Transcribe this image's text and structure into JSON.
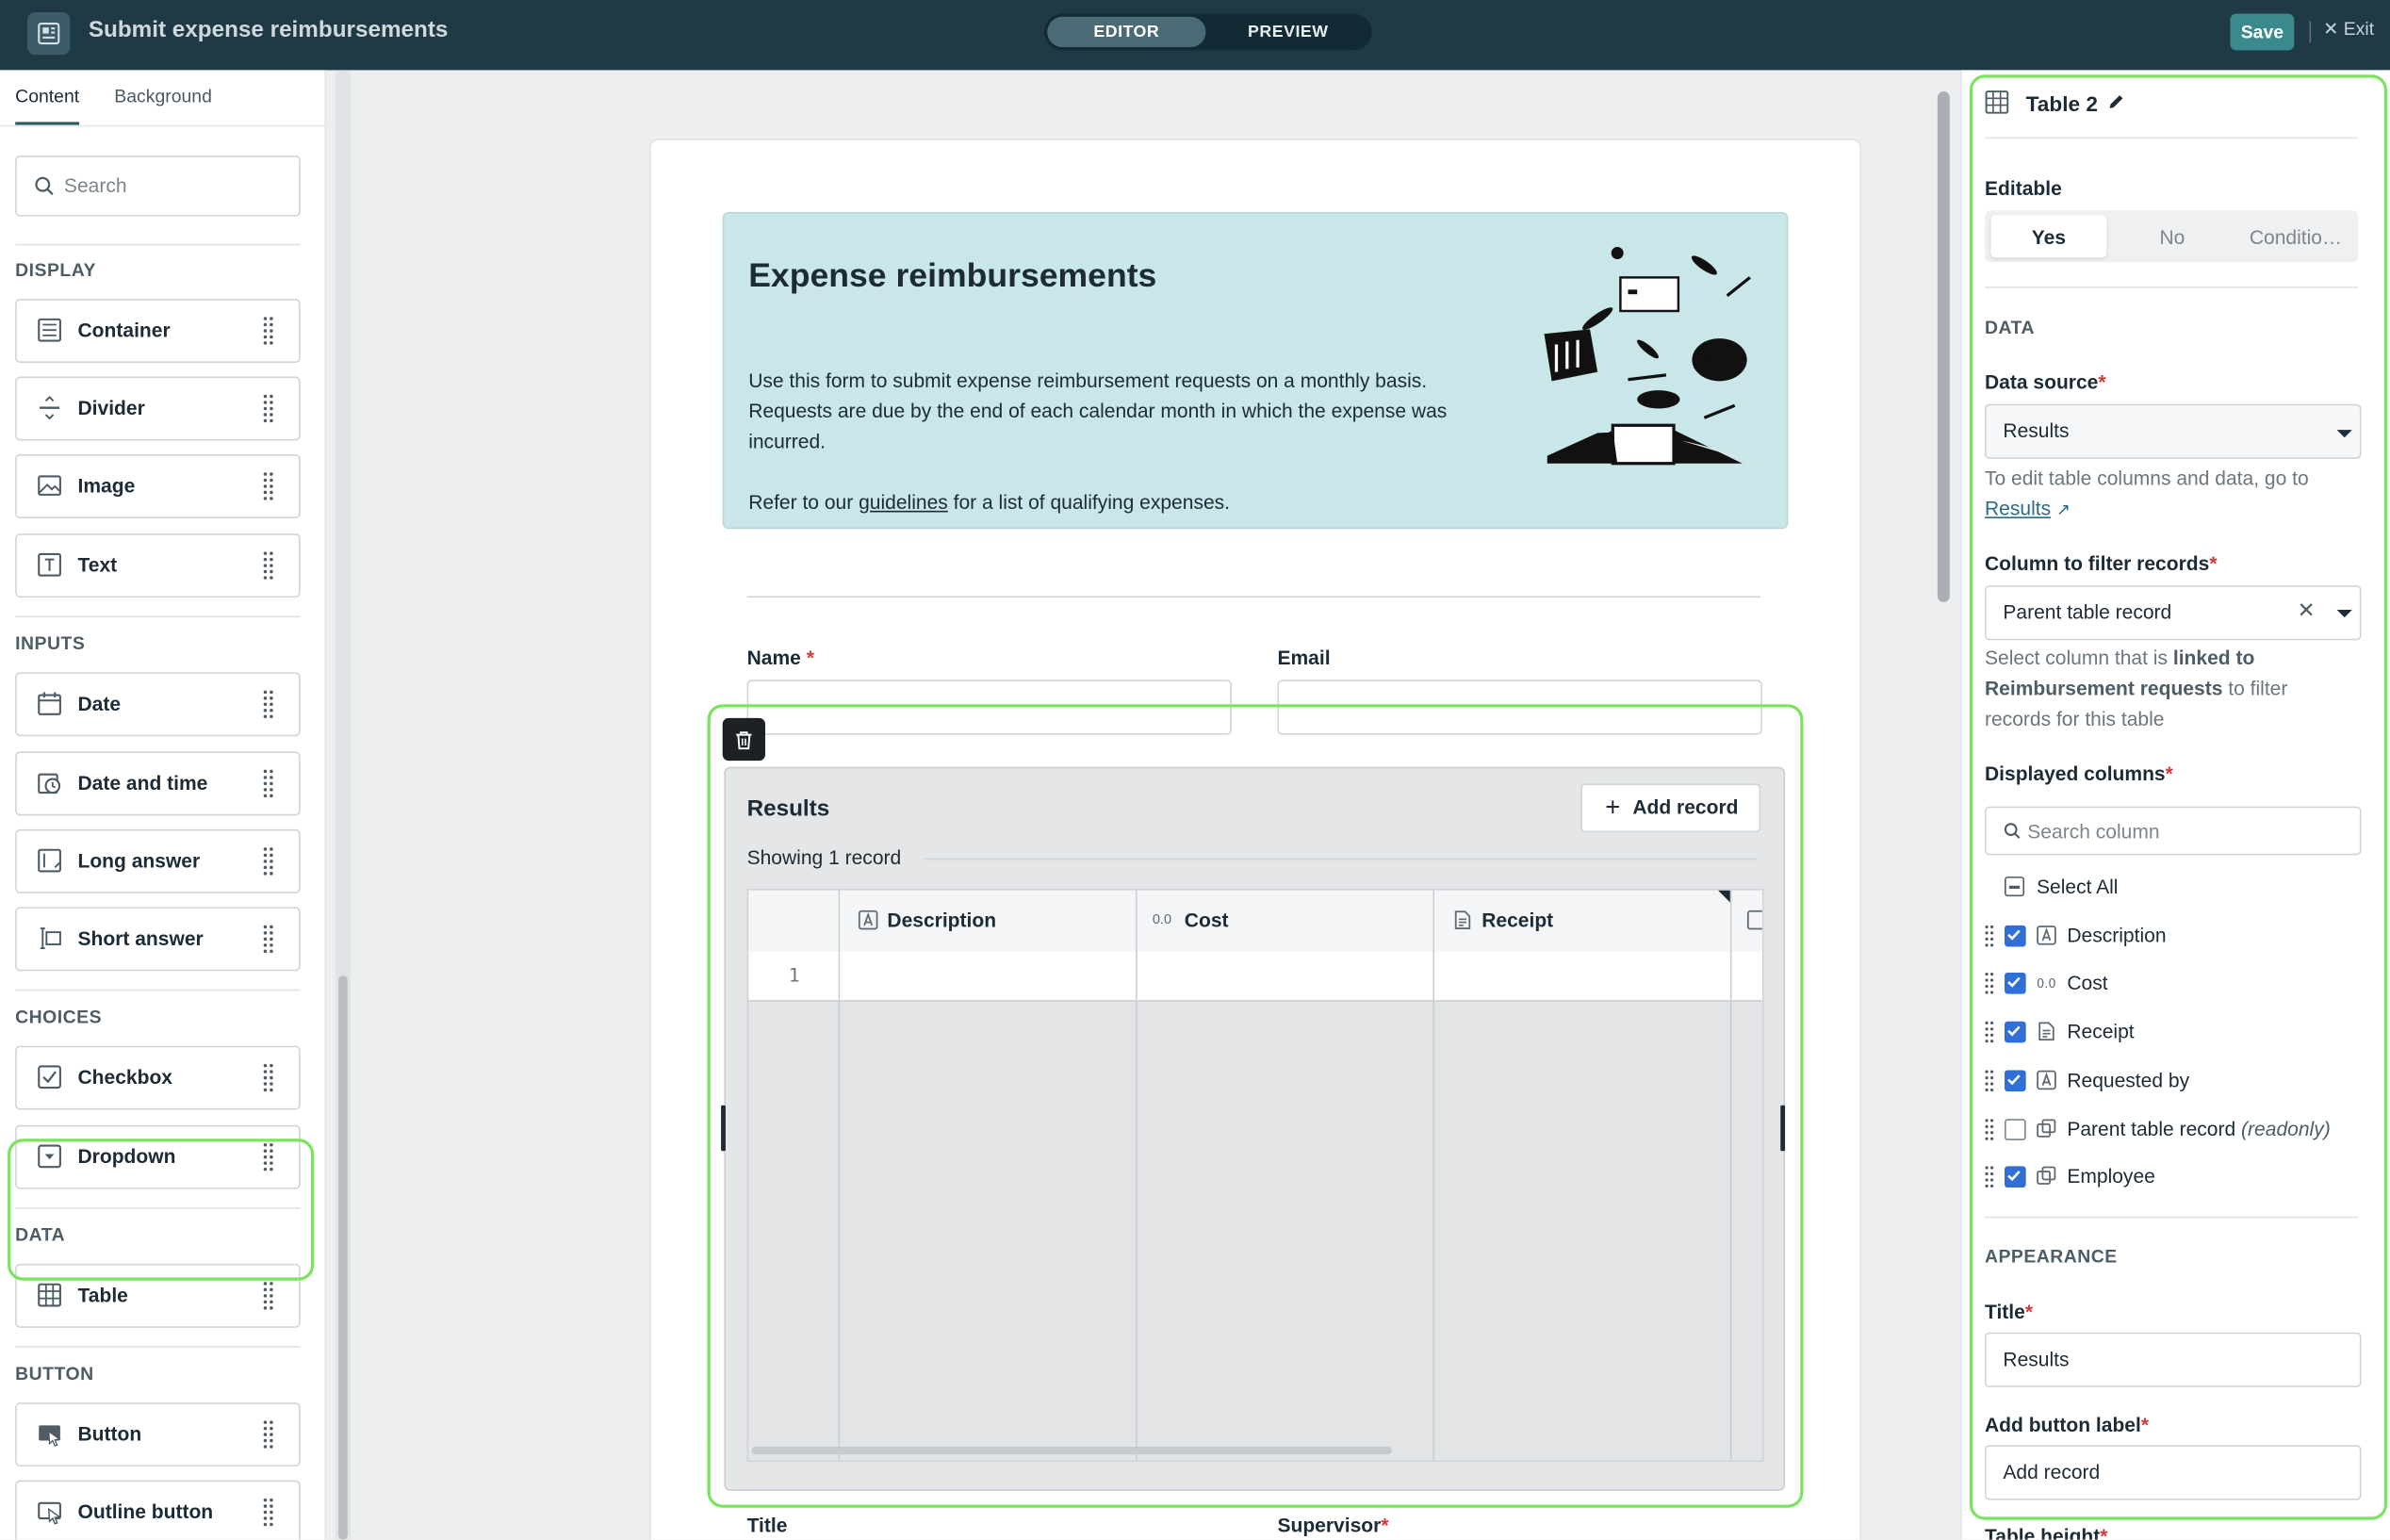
{
  "app": {
    "title": "Submit expense reimbursements",
    "modes": [
      "EDITOR",
      "PREVIEW"
    ],
    "active_mode": "EDITOR",
    "save_label": "Save",
    "exit_label": "Exit",
    "exit_icon": "close-icon",
    "highlight_color": "#7be35f",
    "accent": "#3a8a8d"
  },
  "left_panel": {
    "tabs": [
      "Content",
      "Background"
    ],
    "search_placeholder": "Search",
    "sections": [
      {
        "label": "DISPLAY",
        "items": [
          {
            "label": "Container",
            "icon": "container-icon"
          },
          {
            "label": "Divider",
            "icon": "divider-icon"
          },
          {
            "label": "Image",
            "icon": "image-icon"
          },
          {
            "label": "Text",
            "icon": "text-icon"
          }
        ]
      },
      {
        "label": "INPUTS",
        "items": [
          {
            "label": "Date",
            "icon": "calendar-icon"
          },
          {
            "label": "Date and time",
            "icon": "calendar-clock-icon"
          },
          {
            "label": "Long answer",
            "icon": "long-answer-icon"
          },
          {
            "label": "Short answer",
            "icon": "short-answer-icon"
          }
        ]
      },
      {
        "label": "CHOICES",
        "items": [
          {
            "label": "Checkbox",
            "icon": "checkbox-icon"
          },
          {
            "label": "Dropdown",
            "icon": "dropdown-icon"
          }
        ]
      },
      {
        "label": "DATA",
        "items": [
          {
            "label": "Table",
            "icon": "table-icon"
          }
        ]
      },
      {
        "label": "BUTTON",
        "items": [
          {
            "label": "Button",
            "icon": "button-icon"
          },
          {
            "label": "Outline button",
            "icon": "outline-button-icon"
          }
        ]
      }
    ]
  },
  "form": {
    "banner": {
      "title": "Expense reimbursements",
      "paragraph1": "Use this form to submit expense reimbursement requests on a monthly basis. Requests are due by the end of each calendar month in which the expense was incurred.",
      "p2_before": "Refer to our ",
      "p2_link": "guidelines",
      "p2_after": " for a list of qualifying expenses."
    },
    "fields": {
      "name_label": "Name",
      "email_label": "Email",
      "title_label": "Title",
      "supervisor_label": "Supervisor",
      "required_mark": "*"
    },
    "table": {
      "title": "Results",
      "add_button": "Add record",
      "showing": "Showing 1 record",
      "columns": [
        {
          "label": "Description",
          "type_icon": "text-type-icon"
        },
        {
          "label": "Cost",
          "type_icon": "number-type-icon",
          "type_glyph": "0.0"
        },
        {
          "label": "Receipt",
          "type_icon": "file-type-icon"
        }
      ],
      "row_numbers": [
        "1"
      ]
    }
  },
  "right_panel": {
    "component_name": "Table 2",
    "editable_label": "Editable",
    "editable_options": [
      "Yes",
      "No",
      "Conditio…"
    ],
    "editable_selected": "Yes",
    "data_section": "DATA",
    "data_source_label": "Data source",
    "data_source_value": "Results",
    "data_source_help": "To edit table columns and data, go to",
    "data_source_link": "Results",
    "filter_label": "Column to filter records",
    "filter_value": "Parent table record",
    "filter_help_a": "Select column that is ",
    "filter_help_b": "linked to Reimbursement requests",
    "filter_help_c": " to filter records for this table",
    "displayed_label": "Displayed columns",
    "column_search_placeholder": "Search column",
    "select_all": "Select All",
    "columns": [
      {
        "name": "Description",
        "checked": true,
        "icon": "text-type-icon"
      },
      {
        "name": "Cost",
        "checked": true,
        "icon": "number-type-icon"
      },
      {
        "name": "Receipt",
        "checked": true,
        "icon": "file-type-icon"
      },
      {
        "name": "Requested by",
        "checked": true,
        "icon": "text-type-icon"
      },
      {
        "name": "Parent table record",
        "note": "(readonly)",
        "checked": false,
        "icon": "link-type-icon"
      },
      {
        "name": "Employee",
        "checked": true,
        "icon": "link-type-icon"
      }
    ],
    "appearance_section": "APPEARANCE",
    "title_label": "Title",
    "title_value": "Results",
    "add_button_label": "Add button label",
    "add_button_value": "Add record",
    "table_height_label": "Table height"
  }
}
